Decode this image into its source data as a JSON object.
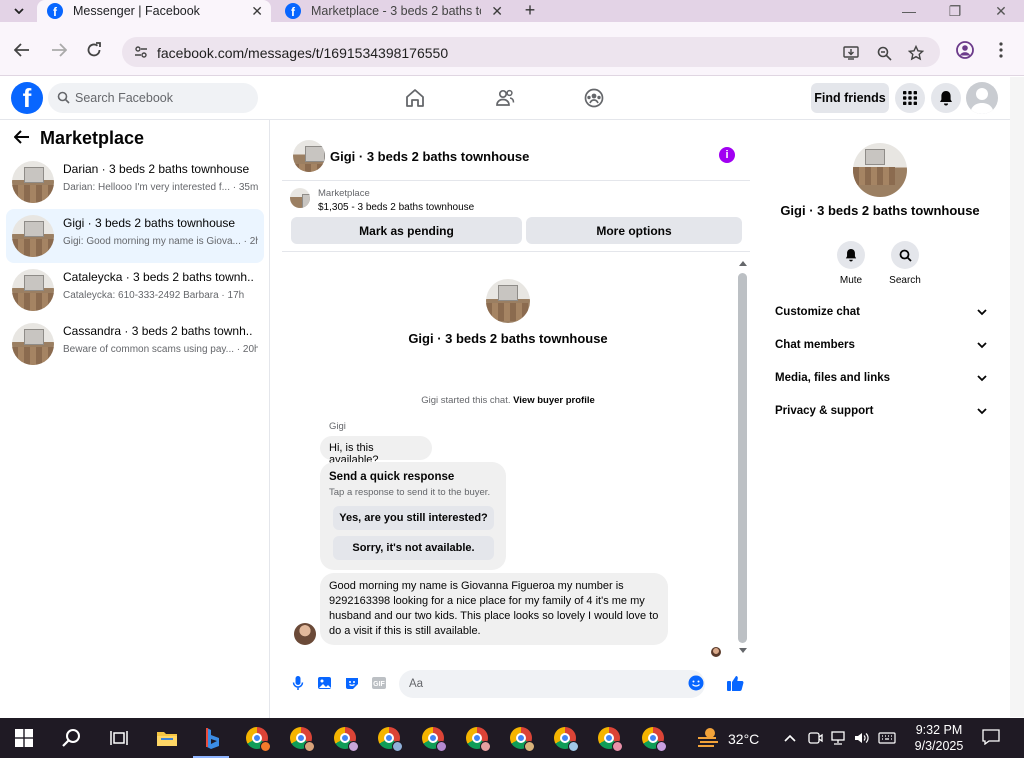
{
  "browser": {
    "tabs": [
      {
        "title": "Messenger | Facebook",
        "active": true
      },
      {
        "title": "Marketplace - 3 beds 2 baths to",
        "active": false
      }
    ],
    "url": "facebook.com/messages/t/1691534398176550"
  },
  "fb": {
    "search_placeholder": "Search Facebook",
    "find_friends": "Find friends"
  },
  "sidebar": {
    "title": "Marketplace",
    "chats": [
      {
        "name": "Darian · 3 beds 2 baths townhouse",
        "preview": "Darian: Hellooo I'm very interested f... · 35m",
        "selected": false
      },
      {
        "name": "Gigi · 3 beds 2 baths townhouse",
        "preview": "Gigi: Good morning my name is Giova... · 2h",
        "selected": true
      },
      {
        "name": "Cataleycka · 3 beds 2 baths townh...",
        "preview": "Cataleycka: 610-333-2492 Barbara · 17h",
        "selected": false
      },
      {
        "name": "Cassandra · 3 beds 2 baths townh...",
        "preview": "Beware of common scams using pay... · 20h",
        "selected": false
      }
    ]
  },
  "conversation": {
    "title": "Gigi · 3 beds 2 baths townhouse",
    "marketplace_label": "Marketplace",
    "listing": "$1,305 - 3 beds 2 baths townhouse",
    "mark_pending": "Mark as pending",
    "more_options": "More options",
    "started_text": "Gigi started this chat.",
    "view_buyer": "View buyer profile",
    "sender": "Gigi",
    "msg1": "Hi, is this available?",
    "quick_title": "Send a quick response",
    "quick_sub": "Tap a response to send it to the buyer.",
    "quick_1": "Yes, are you still interested?",
    "quick_2": "Sorry, it's not available.",
    "msg2": "Good morning my name is Giovanna Figueroa my number is 9292163398 looking for a nice place for my family of 4 it's me my husband and our two kids. This place looks so lovely I would love to do a visit if this is still available.",
    "composer_placeholder": "Aa"
  },
  "details": {
    "title": "Gigi · 3 beds 2 baths townhouse",
    "mute": "Mute",
    "search": "Search",
    "rows": [
      "Customize chat",
      "Chat members",
      "Media, files and links",
      "Privacy & support"
    ]
  },
  "taskbar": {
    "temperature": "32°C",
    "time": "9:32 PM",
    "date": "9/3/2025"
  },
  "colors": {
    "fb_blue": "#0866ff",
    "messenger_purple": "#a100f2",
    "chrome_bg": "#e3d3e6"
  }
}
